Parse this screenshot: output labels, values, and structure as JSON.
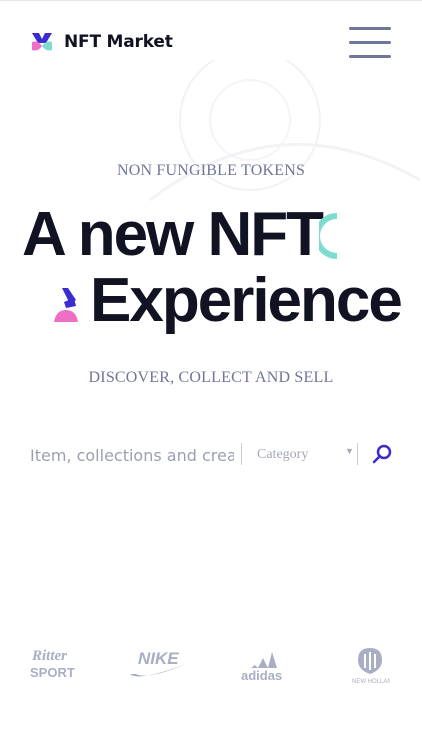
{
  "header": {
    "brand_name": "NFT Market",
    "logo_icon": "nft-market-logo-icon",
    "menu_icon": "hamburger-menu-icon"
  },
  "hero": {
    "eyebrow": "NON FUNGIBLE TOKENS",
    "title_line1": "A new NFT",
    "title_line2": "Experience",
    "subtitle": "DISCOVER, COLLECT AND SELL"
  },
  "search": {
    "placeholder": "Item, collections and creators",
    "category_value": "Category",
    "button_icon": "search-icon"
  },
  "partners": {
    "logos": [
      "Ritter Sport",
      "Nike",
      "adidas",
      "New Holland"
    ]
  },
  "colors": {
    "ink": "#111322",
    "muted": "#6f7698",
    "teal": "#7ddcd0",
    "pink": "#ee6fc5",
    "indigo": "#3b2bd1"
  }
}
